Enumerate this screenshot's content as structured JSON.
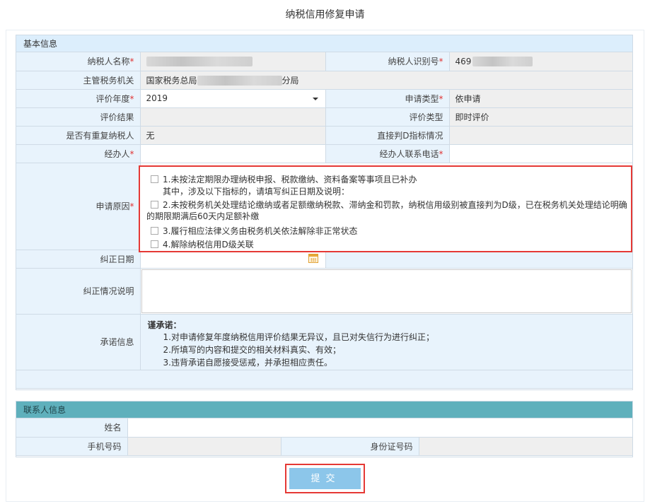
{
  "page_title": "纳税信用修复申请",
  "basic": {
    "section_title": "基本信息",
    "taxpayer_name_label": "纳税人名称",
    "taxpayer_id_label": "纳税人识别号",
    "taxpayer_id_value": "469",
    "authority_label": "主管税务机关",
    "authority_prefix": "国家税务总局",
    "authority_suffix": "分局",
    "eval_year_label": "评价年度",
    "eval_year_value": "2019",
    "apply_type_label": "申请类型",
    "apply_type_value": "依申请",
    "eval_result_label": "评价结果",
    "eval_result_value": "",
    "eval_type_label": "评价类型",
    "eval_type_value": "即时评价",
    "repeat_label": "是否有重复纳税人",
    "repeat_value": "无",
    "direct_d_label": "直接判D指标情况",
    "direct_d_value": "",
    "handler_label": "经办人",
    "handler_phone_label": "经办人联系电话",
    "reason_label": "申请原因",
    "reasons": {
      "r1": "1.未按法定期限办理纳税申报、税款缴纳、资料备案等事项且已补办",
      "r1_note": "其中，涉及以下指标的，请填写纠正日期及说明：",
      "r2_a": "2.未按税务机关处理结论缴纳或者足额缴纳税款、滞纳金和罚款，纳税信用级别被直接判为D级，已在税务机关处理结论明确",
      "r2_b": "的期限期满后60天内足额补缴",
      "r3": "3.履行相应法律义务由税务机关依法解除非正常状态",
      "r4": "4.解除纳税信用D级关联"
    },
    "correct_date_label": "纠正日期",
    "correct_desc_label": "纠正情况说明",
    "promise_label": "承诺信息",
    "promise": {
      "heading": "谨承诺：",
      "p1": "1.对申请修复年度纳税信用评价结果无异议，且已对失信行为进行纠正；",
      "p2": "2.所填写的内容和提交的相关材料真实、有效；",
      "p3": "3.违背承诺自愿接受惩戒，并承担相应责任。"
    }
  },
  "contact": {
    "section_title": "联系人信息",
    "name_label": "姓名",
    "mobile_label": "手机号码",
    "id_card_label": "身份证号码"
  },
  "submit_label": "提交",
  "required_mark": "*",
  "colors": {
    "label_bg": "#e8f3fc",
    "readonly_bg": "#efefef",
    "contact_header": "#5fb0bc",
    "highlight_border": "#e53935",
    "submit_bg": "#8cc6ea"
  }
}
